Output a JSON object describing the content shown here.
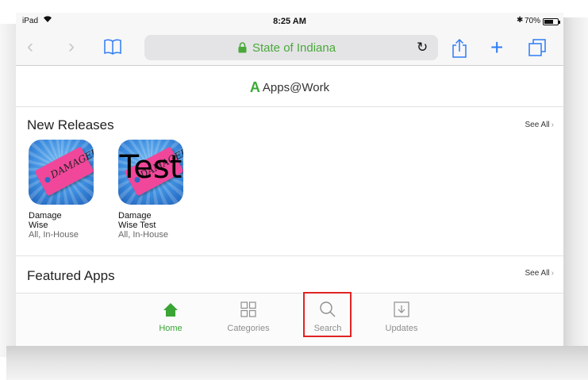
{
  "status": {
    "carrier": "iPad",
    "time": "8:25 AM",
    "battery": "70%",
    "battery_level_percent": 70,
    "icons": [
      "wifi-icon",
      "bluetooth-icon",
      "battery-icon"
    ]
  },
  "browser": {
    "address": "State of Indiana",
    "icons": [
      "back-icon",
      "forward-icon",
      "bookmarks-icon",
      "lock-icon",
      "reload-icon",
      "share-icon",
      "plus-icon",
      "tabs-icon"
    ]
  },
  "header": {
    "brand_logo": "A",
    "brand_name": "Apps@Work"
  },
  "new_releases": {
    "title": "New Releases",
    "see_all": "See All",
    "apps": [
      {
        "name_line1": "Damage",
        "name_line2": "Wise",
        "meta": "All, In-House",
        "tag_text": "DAMAGED",
        "overlay": ""
      },
      {
        "name_line1": "Damage",
        "name_line2": "Wise Test",
        "meta": "All, In-House",
        "tag_text": "DAMAGED",
        "overlay": "Test"
      }
    ]
  },
  "featured": {
    "title": "Featured Apps",
    "see_all": "See All"
  },
  "tabs": [
    {
      "label": "Home",
      "icon": "home-icon",
      "active": true
    },
    {
      "label": "Categories",
      "icon": "categories-icon",
      "active": false
    },
    {
      "label": "Search",
      "icon": "search-icon",
      "active": false
    },
    {
      "label": "Updates",
      "icon": "updates-icon",
      "active": false
    }
  ],
  "colors": {
    "accent_green": "#3aa535",
    "ios_blue": "#2f7cf6",
    "highlight_red": "#e02424"
  }
}
